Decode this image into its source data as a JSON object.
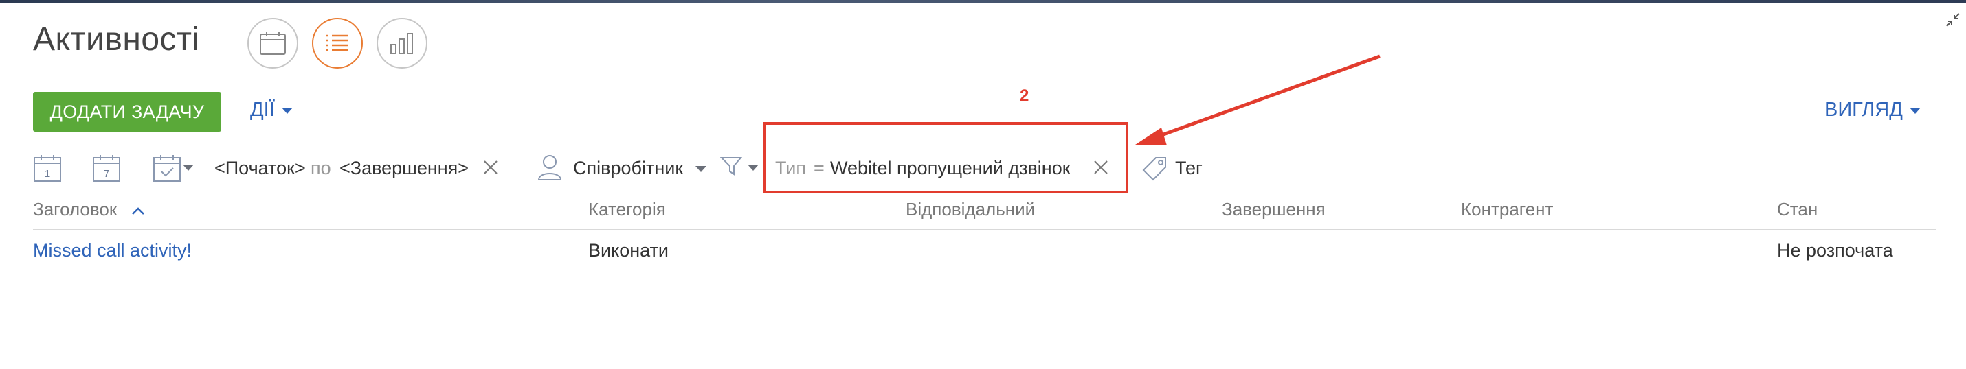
{
  "header": {
    "title": "Активності",
    "view_buttons": [
      "calendar-view",
      "list-view",
      "analytics-view"
    ]
  },
  "toolbar": {
    "add_task_label": "ДОДАТИ ЗАДАЧУ",
    "actions_label": "ДІЇ",
    "view_label": "ВИГЛЯД"
  },
  "filters": {
    "day_icon_text": "1",
    "week_icon_text": "7",
    "start_placeholder": "<Початок>",
    "range_separator": "по",
    "end_placeholder": "<Завершення>",
    "employee_label": "Співробітник",
    "type_field": "Тип",
    "type_operator": "=",
    "type_value": "Webitel пропущений дзвінок",
    "tag_label": "Тег"
  },
  "annotation": {
    "number": "2"
  },
  "table": {
    "columns": [
      "Заголовок",
      "Категорія",
      "Відповідальний",
      "Завершення",
      "Контрагент",
      "Стан"
    ],
    "rows": [
      {
        "title": "Missed call activity!",
        "category": "Виконати",
        "owner": "",
        "due": "",
        "account": "",
        "status": "Не розпочата"
      }
    ]
  },
  "colors": {
    "accent_orange": "#e97c33",
    "primary_green": "#5aa939",
    "link_blue": "#2f64b9",
    "annotation_red": "#e23c2e"
  }
}
